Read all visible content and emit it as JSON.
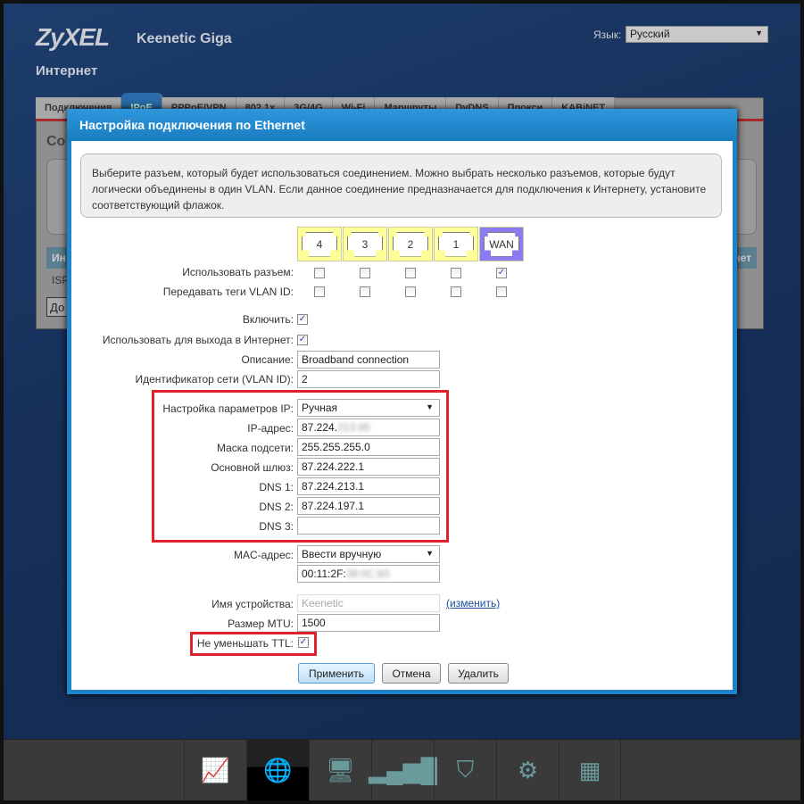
{
  "header": {
    "logo": "ZyXEL",
    "model": "Keenetic Giga",
    "lang_label": "Язык:",
    "lang_value": "Русский",
    "section": "Интернет"
  },
  "tabs": [
    "Подключения",
    "IPoE",
    "PPPoE/VPN",
    "802.1x",
    "3G/4G",
    "Wi-Fi",
    "Маршруты",
    "DyDNS",
    "Прокси",
    "KABiNET"
  ],
  "active_tab": "IPoE",
  "background_fragments": {
    "heading": "Со",
    "col_left": "Ин",
    "col_right": "нет",
    "row": "ISP",
    "button": "До"
  },
  "dialog": {
    "title": "Настройка подключения по Ethernet",
    "info": "Выберите разъем, который будет использоваться соединением. Можно выбрать несколько разъемов, которые будут логически объединены в один VLAN. Если данное соединение предназначается для подключения к Интернету, установите соответствующий флажок.",
    "ports": [
      {
        "label": "4",
        "use": false,
        "tag": false
      },
      {
        "label": "3",
        "use": false,
        "tag": false
      },
      {
        "label": "2",
        "use": false,
        "tag": false
      },
      {
        "label": "1",
        "use": false,
        "tag": false
      },
      {
        "label": "WAN",
        "use": true,
        "tag": false
      }
    ],
    "use_port_label": "Использовать разъем:",
    "vlan_tags_label": "Передавать теги VLAN ID:",
    "enable_label": "Включить:",
    "enable": true,
    "internet_label": "Использовать для выхода в Интернет:",
    "internet": true,
    "description_label": "Описание:",
    "description": "Broadband connection",
    "vlan_label": "Идентификатор сети (VLAN ID):",
    "vlan": "2",
    "ip_mode_label": "Настройка параметров IP:",
    "ip_mode": "Ручная",
    "ip_label": "IP-адрес:",
    "ip": "87.224.",
    "ip_blurred": "213.95",
    "mask_label": "Маска подсети:",
    "mask": "255.255.255.0",
    "gateway_label": "Основной шлюз:",
    "gateway": "87.224.222.1",
    "dns1_label": "DNS 1:",
    "dns1": "87.224.213.1",
    "dns2_label": "DNS 2:",
    "dns2": "87.224.197.1",
    "dns3_label": "DNS 3:",
    "dns3": "",
    "mac_label": "MAC-адрес:",
    "mac_mode": "Ввести вручную",
    "mac": "00:11:2F:",
    "mac_blurred": "38:0C:83",
    "device_name_label": "Имя устройства:",
    "device_name": "Keenetic",
    "change_link": "(изменить)",
    "mtu_label": "Размер MTU:",
    "mtu": "1500",
    "ttl_label": "Не уменьшать TTL:",
    "ttl": true,
    "apply": "Применить",
    "cancel": "Отмена",
    "delete": "Удалить",
    "highlight_color": "#e0202a"
  },
  "dock": [
    {
      "icon": "monitor-chart-icon"
    },
    {
      "icon": "globe-icon",
      "active": true
    },
    {
      "icon": "computers-icon"
    },
    {
      "icon": "signal-bars-icon"
    },
    {
      "icon": "shield-icon"
    },
    {
      "icon": "gear-icon"
    },
    {
      "icon": "apps-grid-icon"
    }
  ]
}
